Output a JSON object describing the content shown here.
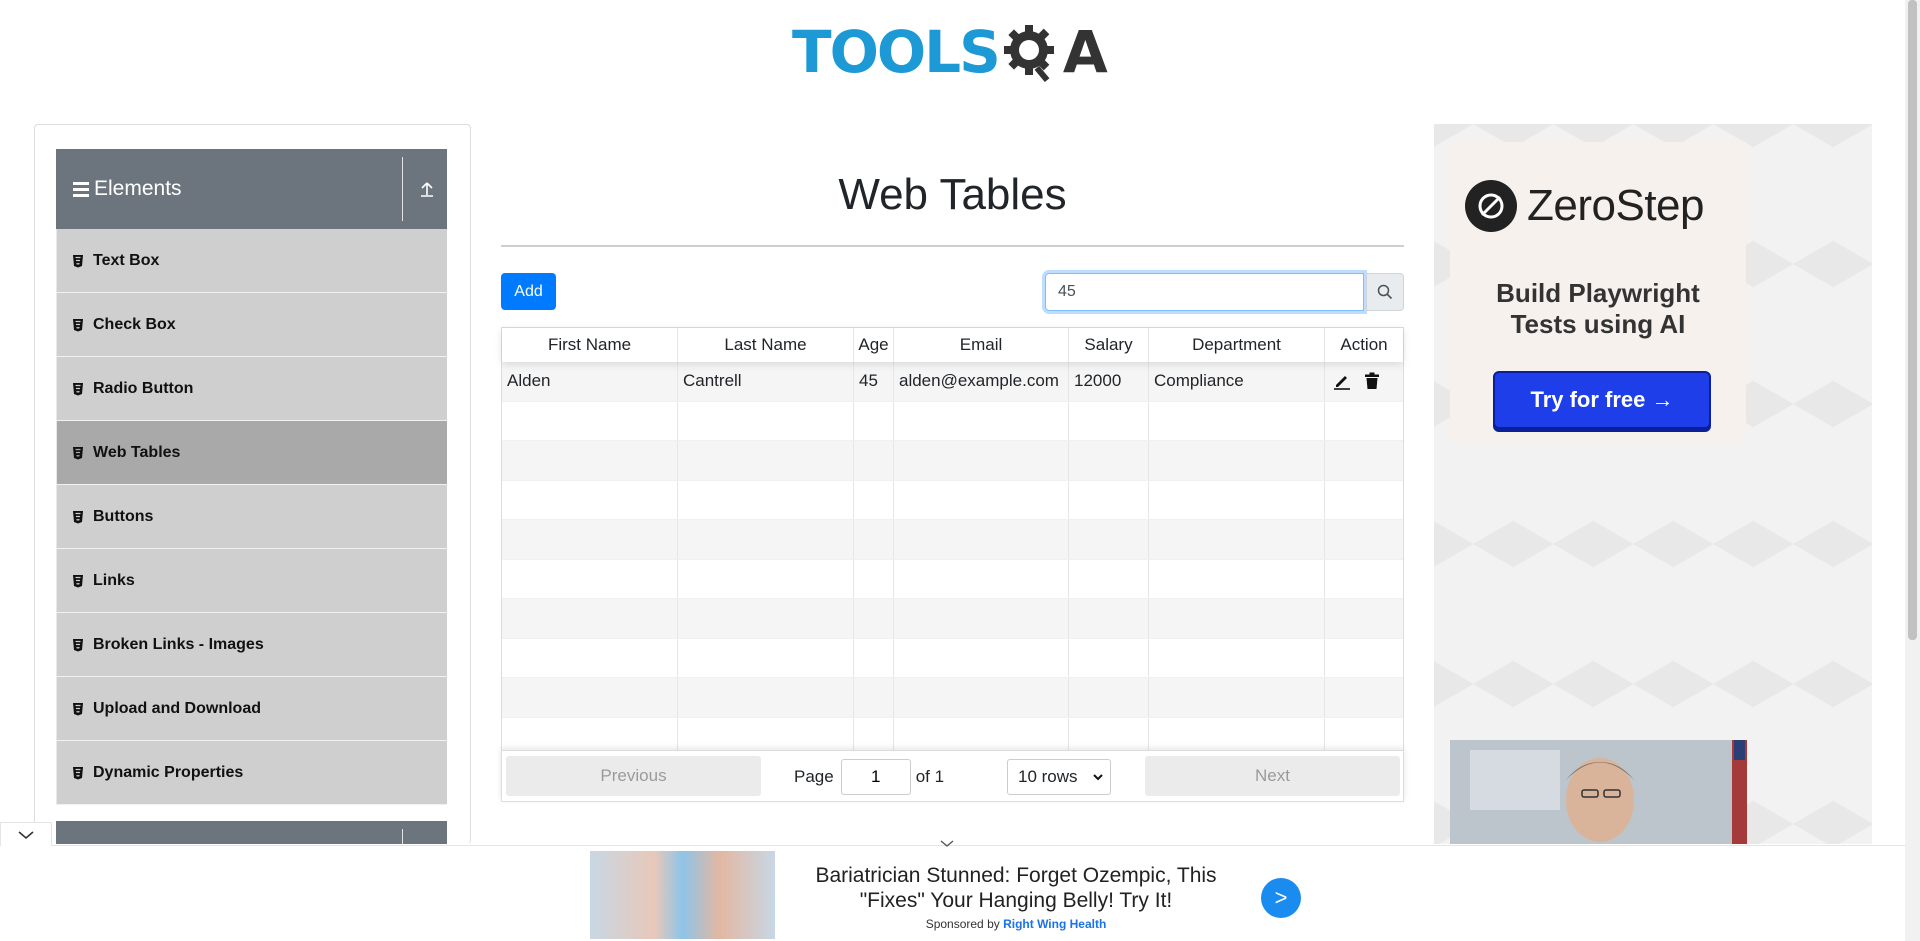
{
  "logo": {
    "part1": "TOOLS",
    "part2": "A"
  },
  "sidebar": {
    "group_title": "Elements",
    "items": [
      {
        "label": "Text Box"
      },
      {
        "label": "Check Box"
      },
      {
        "label": "Radio Button"
      },
      {
        "label": "Web Tables",
        "active": true
      },
      {
        "label": "Buttons"
      },
      {
        "label": "Links"
      },
      {
        "label": "Broken Links - Images"
      },
      {
        "label": "Upload and Download"
      },
      {
        "label": "Dynamic Properties"
      }
    ]
  },
  "main": {
    "title": "Web Tables",
    "add_label": "Add",
    "search": {
      "value": "45"
    },
    "table": {
      "headers": [
        "First Name",
        "Last Name",
        "Age",
        "Email",
        "Salary",
        "Department",
        "Action"
      ],
      "rows": [
        {
          "first": "Alden",
          "last": "Cantrell",
          "age": "45",
          "email": "alden@example.com",
          "salary": "12000",
          "department": "Compliance"
        }
      ]
    },
    "pagination": {
      "previous": "Previous",
      "page_label": "Page",
      "page_value": "1",
      "of_label": "of 1",
      "rows_option": "10 rows",
      "next": "Next"
    }
  },
  "ads": {
    "right": {
      "brand": "ZeroStep",
      "tagline_line1": "Build Playwright",
      "tagline_line2": "Tests using AI",
      "cta": "Try for free →"
    },
    "bottom": {
      "headline": "Bariatrician Stunned: Forget Ozempic, This \"Fixes\" Your Hanging Belly! Try It!",
      "sponsored_prefix": "Sponsored by",
      "sponsor": "Right Wing Health",
      "go": ">"
    }
  },
  "colors": {
    "primary": "#007bff",
    "sidebar_header": "#6c757d",
    "menu_item": "#cfcfcf",
    "menu_active": "#a9a9a9"
  }
}
